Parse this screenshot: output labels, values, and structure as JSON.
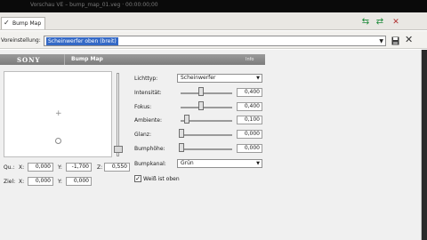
{
  "window": {
    "title_text": "Vorschau VE   –   bump_map_01.veg   ·   00:00:00;00"
  },
  "tab": {
    "label": "Bump Map",
    "checked": true
  },
  "toolbar": {
    "icons": [
      "move-left-icon",
      "move-right-icon",
      "remove-icon"
    ]
  },
  "preset": {
    "label": "Voreinstellung:",
    "value": "Scheinwerfer oben (breit)"
  },
  "header": {
    "brand": "SONY",
    "filter_name": "Bump Map",
    "info": "Info"
  },
  "coordinates": {
    "from": {
      "label": "Qu.:",
      "x_label": "X:",
      "x": "0,000",
      "y_label": "Y:",
      "y": "-1,700",
      "z_label": "Z:",
      "z": "0,550"
    },
    "to": {
      "label": "Ziel:",
      "x_label": "X:",
      "x": "0,000",
      "y_label": "Y:",
      "y": "0,000"
    }
  },
  "params": {
    "light_type": {
      "label": "Lichttyp:",
      "value": "Scheinwerfer"
    },
    "sliders": [
      {
        "label": "Intensität:",
        "value": "0,400",
        "level": 0.4
      },
      {
        "label": "Fokus:",
        "value": "0,400",
        "level": 0.4
      },
      {
        "label": "Ambiente:",
        "value": "0,100",
        "level": 0.1
      },
      {
        "label": "Glanz:",
        "value": "0,000",
        "level": 0.0
      },
      {
        "label": "Bumphöhe:",
        "value": "0,000",
        "level": 0.0
      }
    ],
    "bump_channel": {
      "label": "Bumpkanal:",
      "value": "Grün"
    },
    "white_on_top": {
      "label": "Weiß ist oben",
      "checked": true
    }
  },
  "colors": {
    "selection": "#3469c6",
    "header_bar": "#8a8a8a",
    "accent_green": "#1d8a3a"
  }
}
